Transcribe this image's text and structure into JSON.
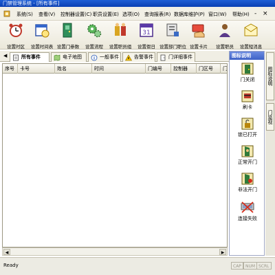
{
  "window": {
    "title": "门禁管理系统 - [所有事件]"
  },
  "menubar": {
    "items": [
      "系统(S)",
      "查看(V)",
      "控制器设置(C)",
      "职员设置(E)",
      "选项(O)",
      "查询报表(R)",
      "数据库维护(P)",
      "窗口(W)",
      "帮助(H)"
    ],
    "window_controls": [
      "-",
      "×"
    ]
  },
  "toolbar": {
    "buttons": [
      {
        "label": "设置时区",
        "icon": "alarm-clock-icon"
      },
      {
        "label": "设置时间表",
        "icon": "calendar-clock-icon"
      },
      {
        "label": "设置门参数",
        "icon": "door-settings-icon"
      },
      {
        "label": "设置流程",
        "icon": "gears-icon"
      },
      {
        "label": "设置职员组",
        "icon": "group-icon"
      },
      {
        "label": "设置假日",
        "icon": "calendar-icon"
      },
      {
        "label": "设置部门职位",
        "icon": "department-icon"
      },
      {
        "label": "设置卡片",
        "icon": "card-hand-icon"
      },
      {
        "label": "设置职员",
        "icon": "person-icon"
      },
      {
        "label": "设置短消息",
        "icon": "message-icon"
      }
    ]
  },
  "tabs": [
    "所有事件",
    "电子地图",
    "一般事件",
    "告警事件",
    "门详细事件"
  ],
  "table": {
    "columns": [
      "序号",
      "卡号",
      "姓名",
      "时间",
      "门编号",
      "控制器",
      "门区号",
      "门"
    ]
  },
  "legend": {
    "title": "图标说明",
    "items": [
      "门关闭",
      "刷卡",
      "锁已打开",
      "正常开门",
      "非法开门",
      "连接失败"
    ]
  },
  "side_tabs": [
    "图标说明",
    "门监视"
  ],
  "status": {
    "text": "Ready",
    "indicators": [
      "CAP",
      "NUM",
      "SCRL"
    ]
  },
  "colors": {
    "title_bar": "#0a3fb3",
    "legend_header": "#3e62c7",
    "warning_tab_icon": "#e0a000"
  }
}
